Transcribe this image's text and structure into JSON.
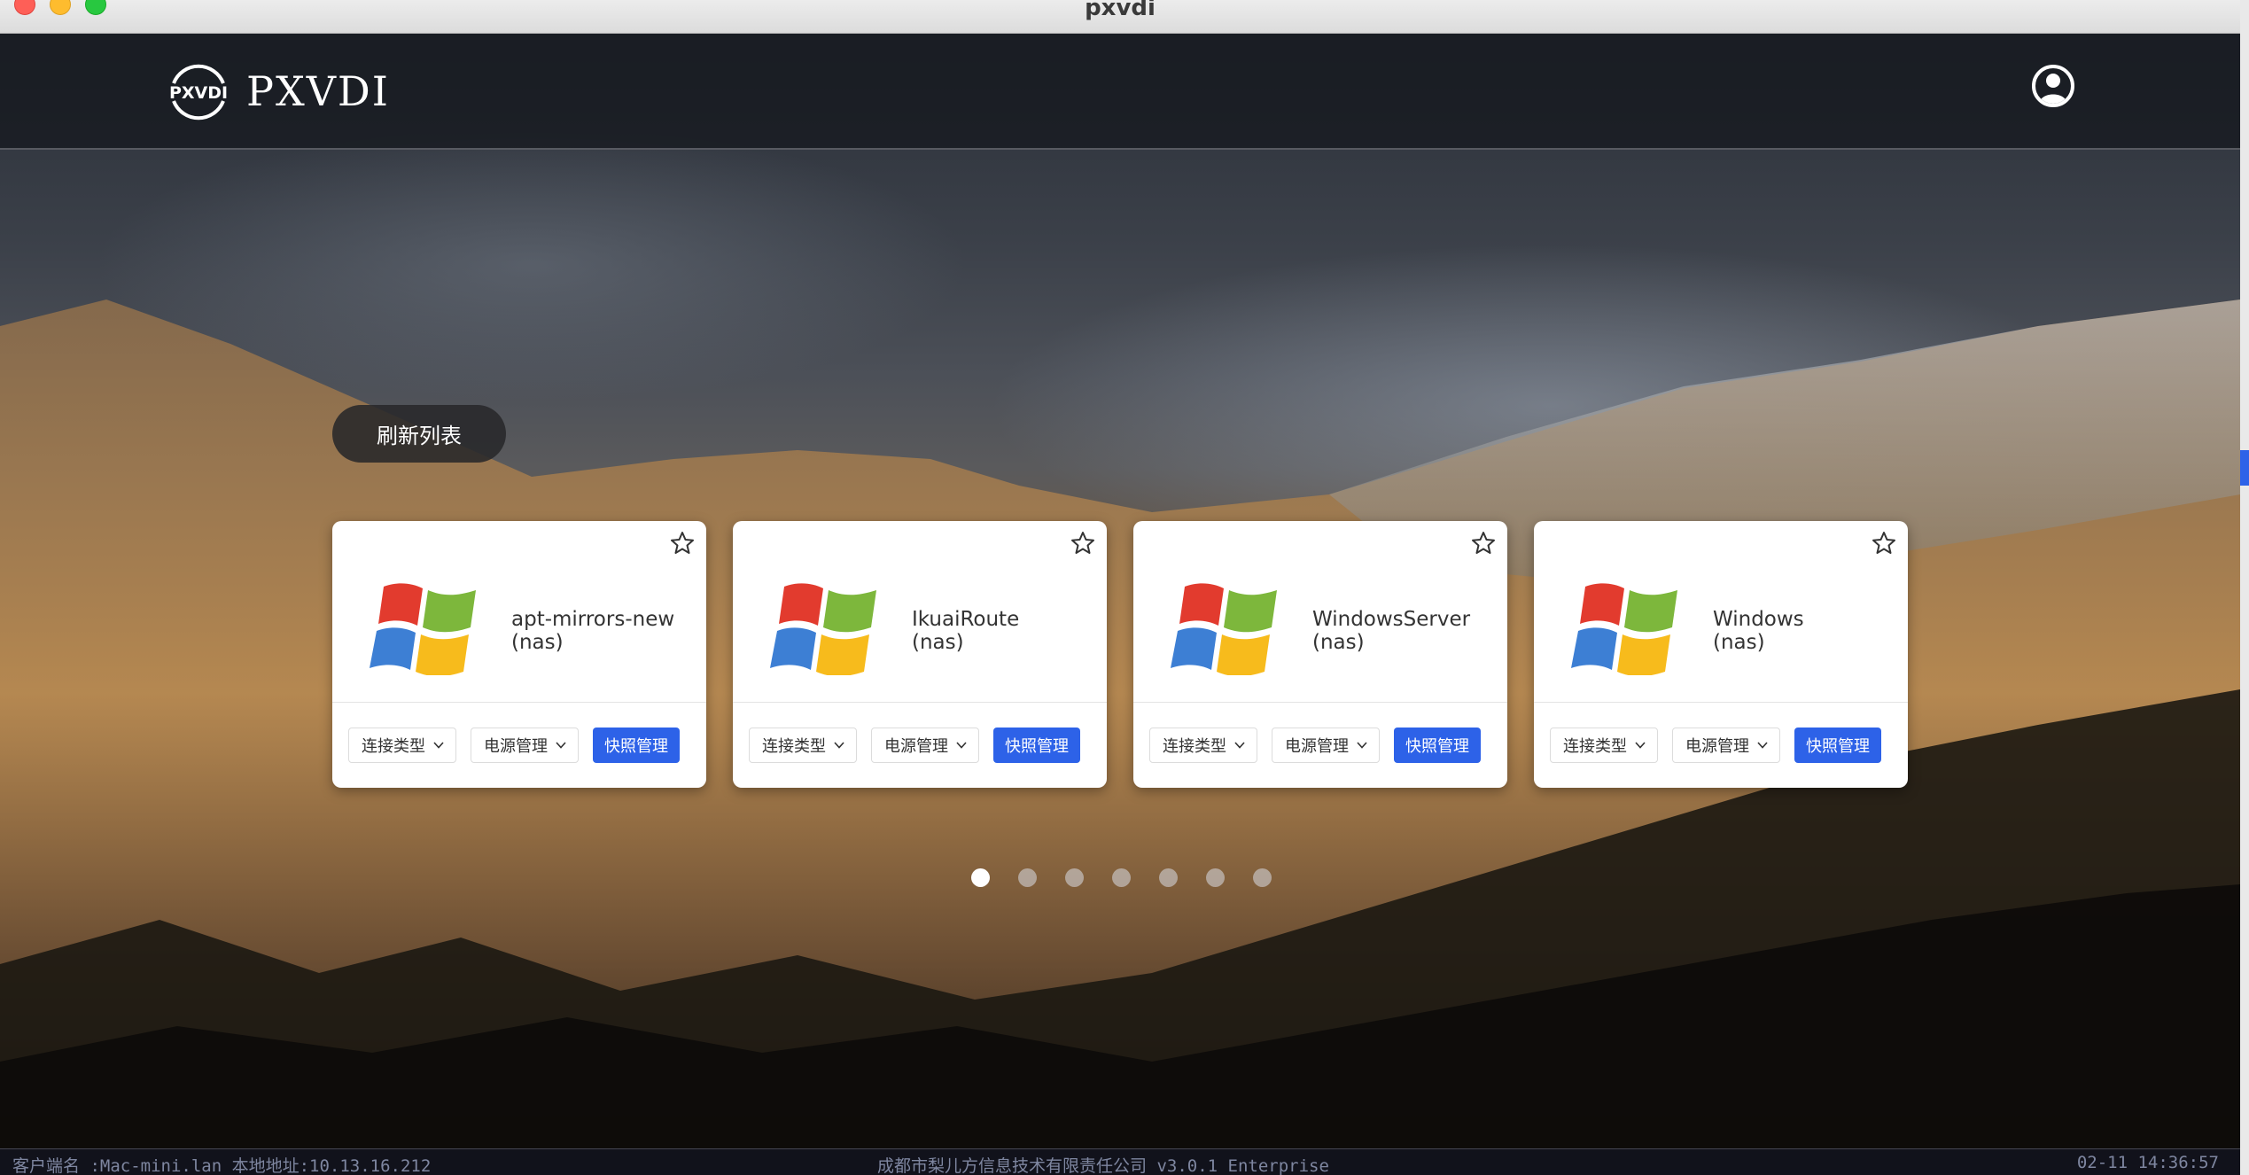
{
  "window": {
    "title": "pxvdi"
  },
  "header": {
    "brand": "PXVDI",
    "badge": "PXVDI"
  },
  "toolbar": {
    "refresh_label": "刷新列表"
  },
  "cards": [
    {
      "name": "apt-mirrors-new",
      "host": "(nas)",
      "connect_label": "连接类型",
      "power_label": "电源管理",
      "snapshot_label": "快照管理"
    },
    {
      "name": "IkuaiRoute",
      "host": "(nas)",
      "connect_label": "连接类型",
      "power_label": "电源管理",
      "snapshot_label": "快照管理"
    },
    {
      "name": "WindowsServer",
      "host": "(nas)",
      "connect_label": "连接类型",
      "power_label": "电源管理",
      "snapshot_label": "快照管理"
    },
    {
      "name": "Windows",
      "host": "(nas)",
      "connect_label": "连接类型",
      "power_label": "电源管理",
      "snapshot_label": "快照管理"
    }
  ],
  "pagination": {
    "total": 7,
    "current": 1
  },
  "status": {
    "client": "客户端名 :Mac-mini.lan  本地地址:10.13.16.212",
    "company": "成都市梨儿方信息技术有限责任公司 v3.0.1  Enterprise",
    "time": "02-11 14:36:57"
  },
  "colors": {
    "accent": "#2d62e8",
    "card_bg": "#ffffff"
  },
  "icons": {
    "user": "user-circle-icon",
    "star": "star-outline-icon",
    "os": "windows-logo-icon",
    "chevron": "chevron-down-icon"
  }
}
